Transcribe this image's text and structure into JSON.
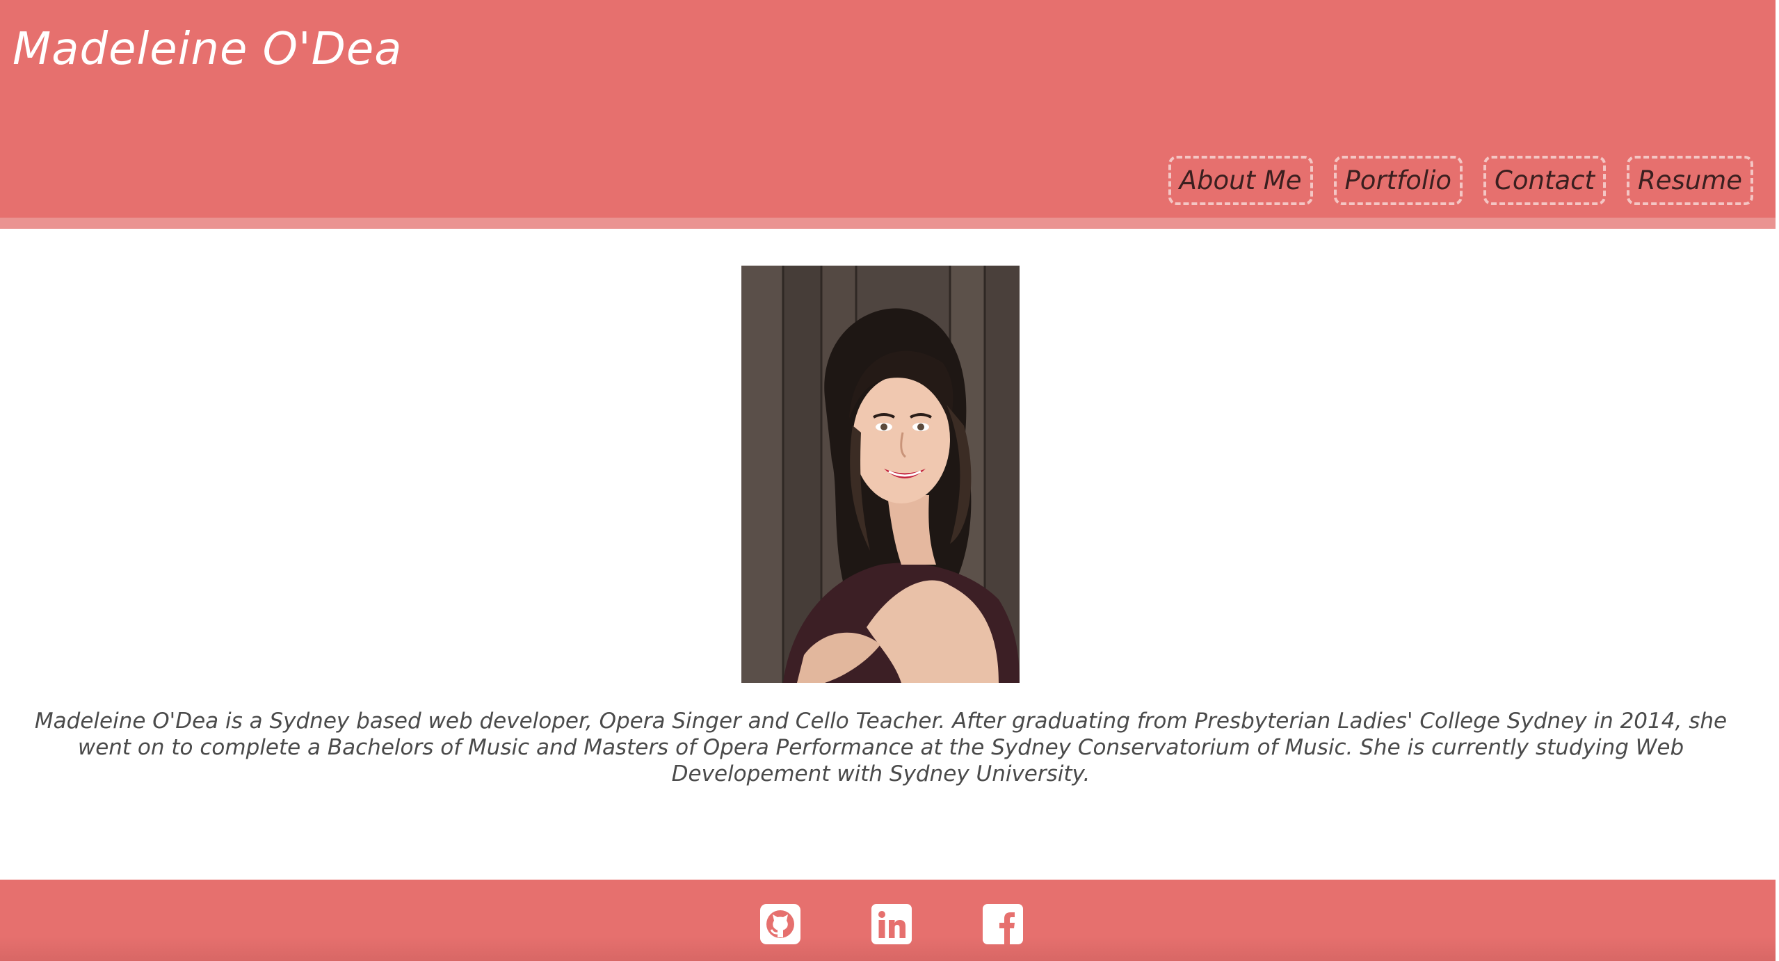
{
  "header": {
    "site_title": "Madeleine O'Dea",
    "nav": [
      {
        "label": "About Me"
      },
      {
        "label": "Portfolio"
      },
      {
        "label": "Contact"
      },
      {
        "label": "Resume"
      }
    ]
  },
  "main": {
    "bio": "Madeleine O'Dea is a Sydney based web developer, Opera Singer and Cello Teacher. After graduating from Presbyterian Ladies' College Sydney in 2014, she went on to complete a Bachelors of Music and Masters of Opera Performance at the Sydney Conservatorium of Music. She is currently studying Web Developement with Sydney University."
  },
  "footer": {
    "social_icons": [
      "github-icon",
      "linkedin-icon",
      "facebook-icon"
    ]
  },
  "colors": {
    "brand": "#e6706e",
    "brand_light": "#ea9391",
    "nav_border": "#f4c6c4",
    "nav_text": "#3a1f1f",
    "title_text": "#ffffff",
    "body_text": "#4a4a4a"
  }
}
